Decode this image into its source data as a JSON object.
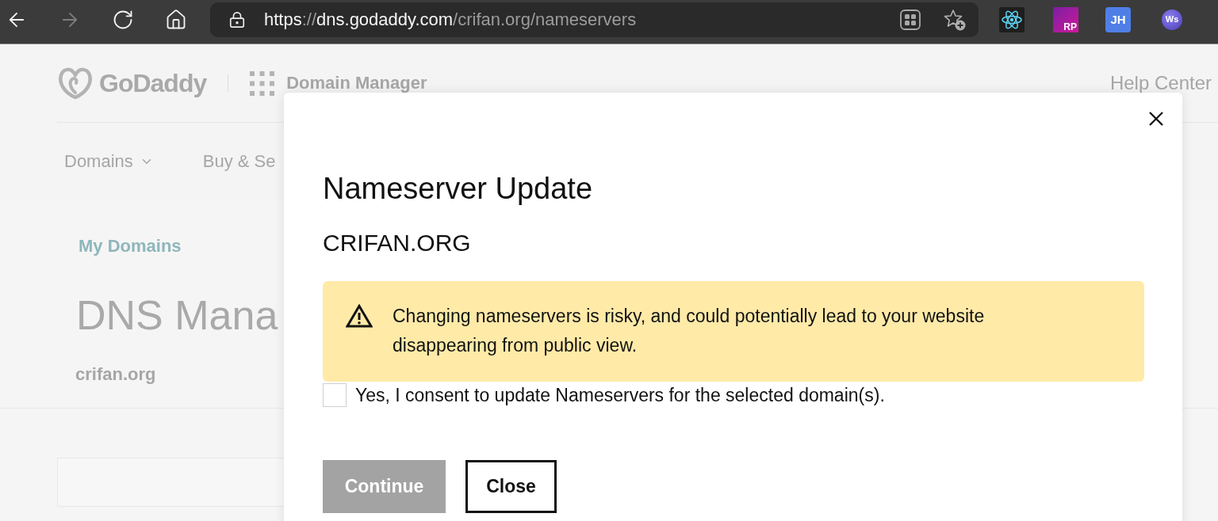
{
  "browser": {
    "toolbar_buttons": [
      {
        "kind": "back",
        "disabled": false
      },
      {
        "kind": "forward",
        "disabled": true
      },
      {
        "kind": "reload",
        "disabled": false
      },
      {
        "kind": "home",
        "disabled": false
      }
    ],
    "url_parts": [
      {
        "text": "https",
        "dim": false
      },
      {
        "text": "://",
        "dim": true
      },
      {
        "text": "dns.godaddy.com",
        "dim": false
      },
      {
        "text": "/crifan.org/nameservers",
        "dim": true
      }
    ],
    "extensions": [
      {
        "kind": "react"
      },
      {
        "kind": "rp",
        "label": "RP"
      },
      {
        "kind": "jh",
        "label": "JH"
      },
      {
        "kind": "ws",
        "label": "Ws"
      }
    ]
  },
  "header": {
    "logo": "GoDaddy",
    "app_name": "Domain Manager",
    "help_link": "Help Center"
  },
  "nav": [
    {
      "label": "Domains",
      "kind": "dropdown"
    },
    {
      "label": "Buy & Se",
      "kind": "link"
    }
  ],
  "page": {
    "breadcrumb": "My Domains",
    "title": "DNS Mana",
    "domain": "crifan.org"
  },
  "modal": {
    "title": "Nameserver Update",
    "domain": "CRIFAN.ORG",
    "warning": "Changing nameservers is risky, and could potentially lead to your website disappearing from public view.",
    "consent": {
      "label": "Yes, I consent to update Nameservers for the selected domain(s).",
      "checked": false
    },
    "buttons": [
      {
        "label": "Continue",
        "kind": "primary",
        "disabled": true
      },
      {
        "label": "Close",
        "kind": "secondary",
        "disabled": false
      }
    ]
  }
}
